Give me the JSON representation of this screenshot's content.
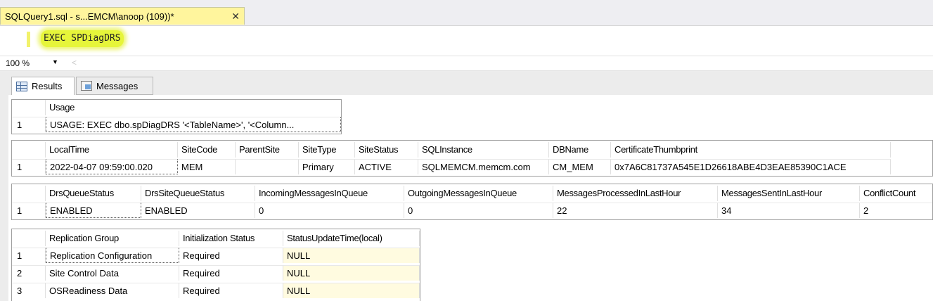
{
  "tab": {
    "title": "SQLQuery1.sql - s...EMCM\\anoop (109))*",
    "close": "✕"
  },
  "editor": {
    "code": "EXEC SPDiagDRS"
  },
  "zoombar": {
    "zoom": "100 %",
    "arrow": "▼",
    "scroll_left": "<"
  },
  "result_tabs": {
    "results": "Results",
    "messages": "Messages"
  },
  "grid1": {
    "headers": [
      "Usage"
    ],
    "rows": [
      [
        "1",
        "USAGE: EXEC dbo.spDiagDRS '<TableName>', '<Column..."
      ]
    ]
  },
  "grid2": {
    "headers": [
      "LocalTime",
      "SiteCode",
      "ParentSite",
      "SiteType",
      "SiteStatus",
      "SQLInstance",
      "DBName",
      "CertificateThumbprint"
    ],
    "rows": [
      [
        "1",
        "2022-04-07 09:59:00.020",
        "MEM",
        "",
        "Primary",
        "ACTIVE",
        "SQLMEMCM.memcm.com",
        "CM_MEM",
        "0x7A6C81737A545E1D26618ABE4D3EAE85390C1ACE"
      ]
    ]
  },
  "grid3": {
    "headers": [
      "DrsQueueStatus",
      "DrsSiteQueueStatus",
      "IncomingMessagesInQueue",
      "OutgoingMessagesInQueue",
      "MessagesProcessedInLastHour",
      "MessagesSentInLastHour",
      "ConflictCount"
    ],
    "rows": [
      [
        "1",
        "ENABLED",
        "ENABLED",
        "0",
        "0",
        "22",
        "34",
        "2"
      ]
    ]
  },
  "grid4": {
    "headers": [
      "Replication Group",
      "Initialization Status",
      "StatusUpdateTime(local)"
    ],
    "rows": [
      [
        "1",
        "Replication Configuration",
        "Required",
        "NULL"
      ],
      [
        "2",
        "Site Control Data",
        "Required",
        "NULL"
      ],
      [
        "3",
        "OSReadiness Data",
        "Required",
        "NULL"
      ]
    ]
  }
}
